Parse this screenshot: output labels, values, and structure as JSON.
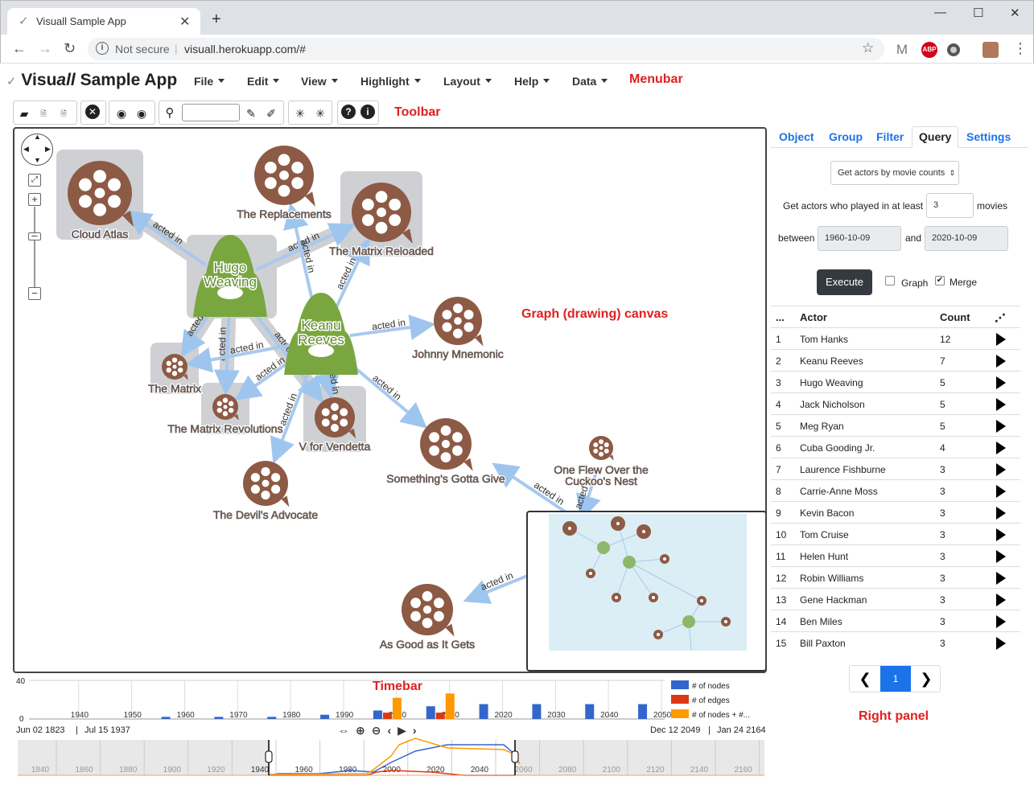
{
  "browser": {
    "tab_title": "Visuall Sample App",
    "new_tab": "+",
    "not_secure": "Not secure",
    "url": "visuall.herokuapp.com/#",
    "window_controls": [
      "minimize-icon",
      "maximize-icon",
      "close-icon"
    ],
    "extensions": [
      "M",
      "ABP"
    ]
  },
  "app": {
    "brand_prefix": "Visu",
    "brand_italic": "all",
    "brand_suffix": " Sample App",
    "menus": [
      "File",
      "Edit",
      "View",
      "Highlight",
      "Layout",
      "Help",
      "Data"
    ],
    "menubar_label": "Menubar",
    "toolbar_label": "Toolbar",
    "canvas_label": "Graph (drawing) canvas",
    "timebar_label": "Timebar",
    "right_panel_label": "Right panel",
    "toolbar_icons": [
      "open-file-icon",
      "save-json-icon",
      "save-png-icon",
      "delete-icon",
      "hide-icon",
      "show-icon",
      "search-icon",
      "highlight-icon",
      "erase-highlight-icon",
      "layout-icon",
      "recalculate-layout-icon",
      "help-icon",
      "info-icon"
    ],
    "search_value": ""
  },
  "graph": {
    "nodes": [
      {
        "id": "cloud",
        "label": "Cloud Atlas",
        "kind": "movie"
      },
      {
        "id": "repl",
        "label": "The Replacements",
        "kind": "movie"
      },
      {
        "id": "reload",
        "label": "The Matrix Reloaded",
        "kind": "movie"
      },
      {
        "id": "hugo",
        "label1": "Hugo",
        "label2": "Weaving",
        "kind": "actor"
      },
      {
        "id": "keanu",
        "label1": "Keanu",
        "label2": "Reeves",
        "kind": "actor"
      },
      {
        "id": "johnny",
        "label": "Johnny Mnemonic",
        "kind": "movie"
      },
      {
        "id": "matrix",
        "label": "The Matrix",
        "kind": "movie"
      },
      {
        "id": "revol",
        "label": "The Matrix Revolutions",
        "kind": "movie"
      },
      {
        "id": "vendetta",
        "label": "V for Vendetta",
        "kind": "movie"
      },
      {
        "id": "devil",
        "label": "The Devil's Advocate",
        "kind": "movie"
      },
      {
        "id": "sgg",
        "label": "Something's Gotta Give",
        "kind": "movie"
      },
      {
        "id": "cuckoo",
        "label1": "One Flew Over the",
        "label2": "Cuckoo's Nest",
        "kind": "movie"
      },
      {
        "id": "asgood",
        "label": "As Good as It Gets",
        "kind": "movie"
      }
    ],
    "edge_label": "acted in"
  },
  "right_panel": {
    "tabs": [
      "Object",
      "Group",
      "Filter",
      "Query",
      "Settings"
    ],
    "active_tab": "Query",
    "query_select": "Get actors by movie counts",
    "prompt_prefix": "Get actors who played in at least",
    "min_count": "3",
    "prompt_suffix": "movies",
    "between": "between",
    "date_from": "1960-10-09",
    "and": "and",
    "date_to": "2020-10-09",
    "execute": "Execute",
    "graph_label": "Graph",
    "graph_checked": false,
    "merge_label": "Merge",
    "merge_checked": true,
    "table": {
      "headers": [
        "...",
        "Actor",
        "Count"
      ],
      "rows": [
        [
          "1",
          "Tom Hanks",
          "12"
        ],
        [
          "2",
          "Keanu Reeves",
          "7"
        ],
        [
          "3",
          "Hugo Weaving",
          "5"
        ],
        [
          "4",
          "Jack Nicholson",
          "5"
        ],
        [
          "5",
          "Meg Ryan",
          "5"
        ],
        [
          "6",
          "Cuba Gooding Jr.",
          "4"
        ],
        [
          "7",
          "Laurence Fishburne",
          "3"
        ],
        [
          "8",
          "Carrie-Anne Moss",
          "3"
        ],
        [
          "9",
          "Kevin Bacon",
          "3"
        ],
        [
          "10",
          "Tom Cruise",
          "3"
        ],
        [
          "11",
          "Helen Hunt",
          "3"
        ],
        [
          "12",
          "Robin Williams",
          "3"
        ],
        [
          "13",
          "Gene Hackman",
          "3"
        ],
        [
          "14",
          "Ben Miles",
          "3"
        ],
        [
          "15",
          "Bill Paxton",
          "3"
        ]
      ]
    },
    "page": "1"
  },
  "timebar": {
    "y_max": "40",
    "y_min": "0",
    "decades": [
      "1940",
      "1950",
      "1960",
      "1970",
      "1980",
      "1990",
      "2000",
      "2010",
      "2020",
      "2030",
      "2040",
      "2050"
    ],
    "legend": [
      "# of nodes",
      "# of edges",
      "# of nodes + #..."
    ],
    "colors": {
      "nodes": "#3366cc",
      "edges": "#dc3912",
      "sum": "#ff9900"
    },
    "nodes_counts": [
      0,
      0,
      1,
      1,
      1,
      2,
      4,
      6,
      7,
      7,
      7,
      7
    ],
    "edges_counts": [
      0,
      0,
      0,
      0,
      0,
      0,
      3,
      3,
      0,
      0,
      0,
      0
    ],
    "sum_counts": [
      0,
      0,
      0,
      0,
      0,
      0,
      10,
      12,
      0,
      0,
      0,
      0
    ],
    "range_start": "Jun 02 1823",
    "cursor_start": "Jul 15 1937",
    "cursor_end": "Dec 12 2049",
    "range_end": "Jan 24 2164",
    "overview_years": [
      "1840",
      "1860",
      "1880",
      "1900",
      "1920",
      "1940",
      "1960",
      "1980",
      "2000",
      "2020",
      "2040",
      "2060",
      "2080",
      "2100",
      "2120",
      "2140",
      "2160"
    ]
  }
}
